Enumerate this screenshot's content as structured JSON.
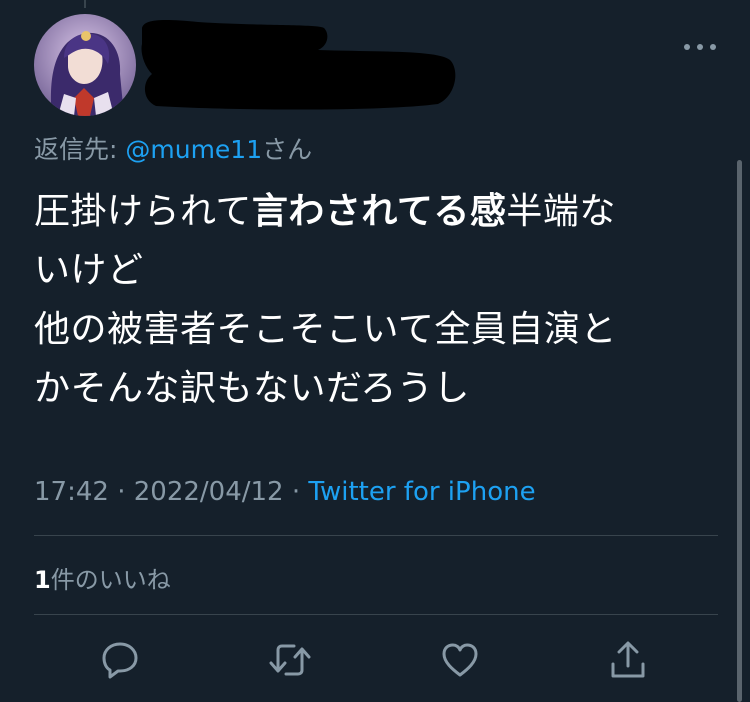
{
  "tweet": {
    "reply_prefix": "返信先: ",
    "reply_handle": "@mume11",
    "reply_suffix": "さん",
    "lines": [
      [
        {
          "text": "圧掛けられて",
          "bold": false
        },
        {
          "text": "言わされてる感",
          "bold": true
        },
        {
          "text": "半端な",
          "bold": false
        }
      ],
      [
        {
          "text": "いけど",
          "bold": false
        }
      ],
      [
        {
          "text": "他の被害者そこそこいて全員自演と",
          "bold": false
        }
      ],
      [
        {
          "text": "かそんな訳もないだろうし",
          "bold": false
        }
      ]
    ],
    "time": "17:42",
    "separator": " · ",
    "date": "2022/04/12",
    "source": "Twitter for iPhone",
    "like_count": "1",
    "like_label": "件のいいね"
  },
  "colors": {
    "background": "#15202b",
    "text": "#ffffff",
    "secondary": "#8899a6",
    "accent": "#1da1f2",
    "divider": "#38444d"
  },
  "icons": [
    "more-icon",
    "reply-icon",
    "retweet-icon",
    "like-icon",
    "share-icon"
  ]
}
